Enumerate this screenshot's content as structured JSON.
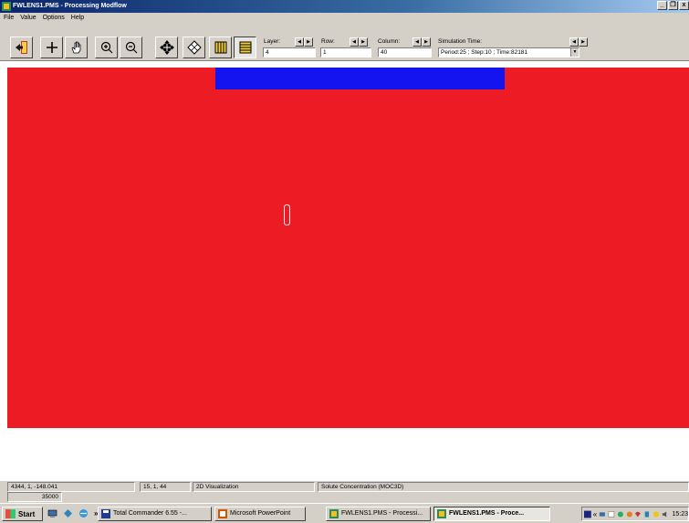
{
  "window": {
    "title": "FWLENS1.PMS - Processing Modflow",
    "buttons": [
      "_",
      "❒",
      "x"
    ]
  },
  "menu": [
    "File",
    "Value",
    "Options",
    "Help"
  ],
  "toolbar": {
    "layer_label": "Layer:",
    "layer_value": "4",
    "row_label": "Row:",
    "row_value": "1",
    "column_label": "Column:",
    "column_value": "40",
    "simtime_label": "Simulation Time:",
    "simtime_value": "Period:25 ; Step:10 ; Time:82181"
  },
  "colors": {
    "grid": "#ed1c24",
    "fixed_cells": "#1414f0",
    "well_outline": "#ffffff"
  },
  "statusbar": {
    "coords": "4344,     1,  -148.041",
    "cell": "15, 1, 44",
    "mode": "2D Visualization",
    "result": "Solute Concentration (MOC3D)",
    "value": "35000"
  },
  "taskbar": {
    "start_label": "Start",
    "chevron": "»",
    "tasks": [
      {
        "label": "Total Commander 6.55 -..."
      },
      {
        "label": "Microsoft PowerPoint"
      },
      {
        "label": "FWLENS1.PMS - Processi..."
      },
      {
        "label": "FWLENS1.PMS - Proce..."
      }
    ],
    "tray_chevron": "«",
    "clock": "15:23"
  }
}
